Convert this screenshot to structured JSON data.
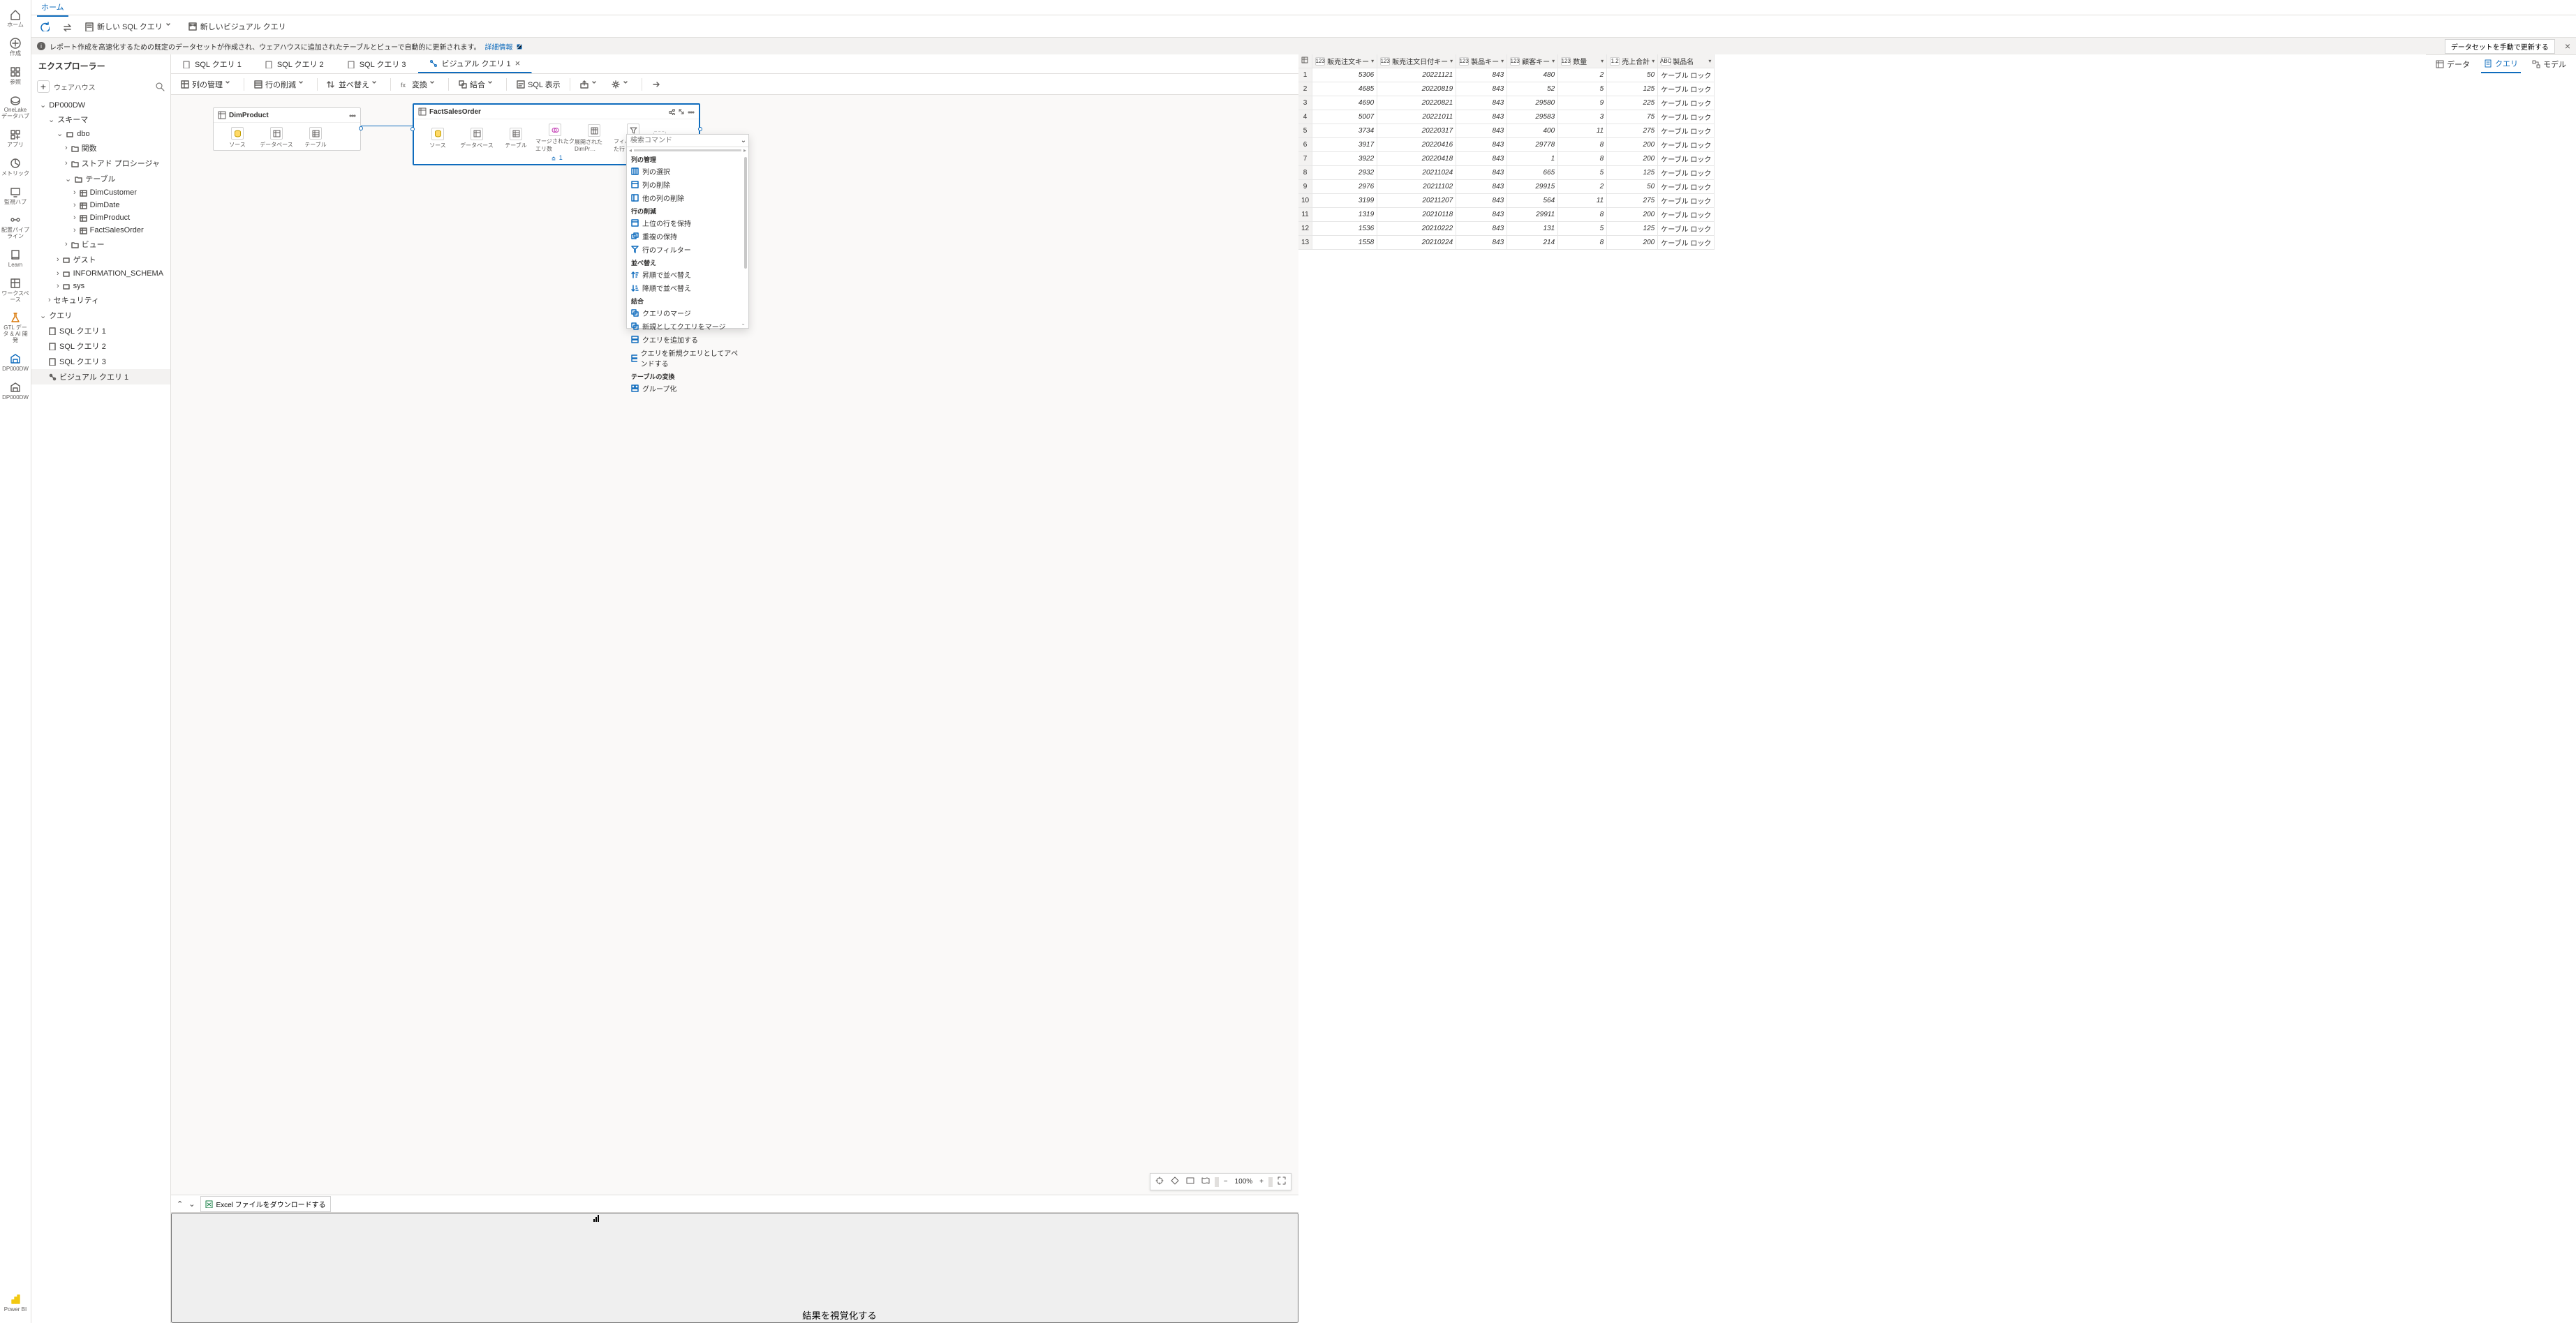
{
  "rail": [
    {
      "icon": "home",
      "label": "ホーム"
    },
    {
      "icon": "plus",
      "label": "作成"
    },
    {
      "icon": "grid",
      "label": "参照"
    },
    {
      "icon": "onelake",
      "label": "OneLake データハブ"
    },
    {
      "icon": "apps",
      "label": "アプリ"
    },
    {
      "icon": "metrics",
      "label": "メトリック"
    },
    {
      "icon": "monitor",
      "label": "監視ハブ"
    },
    {
      "icon": "pipeline",
      "label": "配置パイプライン"
    },
    {
      "icon": "learn",
      "label": "Learn"
    },
    {
      "icon": "workspace",
      "label": "ワークスペース"
    },
    {
      "icon": "flask",
      "label": "GTL データ & AI 開発"
    },
    {
      "icon": "dw",
      "label": "DP000DW"
    },
    {
      "icon": "dw2",
      "label": "DP000DW"
    }
  ],
  "rail_logo": "Power BI",
  "top_tab": "ホーム",
  "ribbon": {
    "refresh": "",
    "newSql": "新しい SQL クエリ",
    "newVisual": "新しいビジュアル クエリ"
  },
  "info": {
    "text": "レポート作成を高速化するための既定のデータセットが作成され、ウェアハウスに追加されたテーブルとビューで自動的に更新されます。",
    "link": "詳細情報",
    "button": "データセットを手動で更新する"
  },
  "explorer": {
    "title": "エクスプローラー",
    "search_label": "ウェアハウス",
    "nodes": {
      "db": "DP000DW",
      "schema": "スキーマ",
      "dbo": "dbo",
      "func": "関数",
      "sproc": "ストアド プロシージャ",
      "table": "テーブル",
      "tables": [
        "DimCustomer",
        "DimDate",
        "DimProduct",
        "FactSalesOrder"
      ],
      "view": "ビュー",
      "guest": "ゲスト",
      "info_schema": "INFORMATION_SCHEMA",
      "sys": "sys",
      "security": "セキュリティ",
      "query": "クエリ",
      "queries": [
        "SQL クエリ 1",
        "SQL クエリ 2",
        "SQL クエリ 3",
        "ビジュアル クエリ 1"
      ]
    }
  },
  "queryTabs": [
    "SQL クエリ 1",
    "SQL クエリ 2",
    "SQL クエリ 3",
    "ビジュアル クエリ 1"
  ],
  "activeTab": 3,
  "vtoolbar": {
    "manageCols": "列の管理",
    "reduceRows": "行の削減",
    "sort": "並べ替え",
    "transform": "変換",
    "combine": "結合",
    "sqlView": "SQL 表示"
  },
  "diagram": {
    "nodeA": {
      "title": "DimProduct",
      "steps": [
        "ソース",
        "データベース",
        "テーブル"
      ]
    },
    "nodeB": {
      "title": "FactSalesOrder",
      "steps": [
        "ソース",
        "データベース",
        "テーブル",
        "マージされたクエリ数",
        "展開された DimPr…",
        "フィルターされた行"
      ],
      "footer": "1"
    }
  },
  "ctx": {
    "search": "検索コマンド",
    "groups": [
      {
        "title": "列の管理",
        "items": [
          "列の選択",
          "列の削除",
          "他の列の削除"
        ]
      },
      {
        "title": "行の削減",
        "items": [
          "上位の行を保持",
          "重複の保持",
          "行のフィルター"
        ]
      },
      {
        "title": "並べ替え",
        "items": [
          "昇順で並べ替え",
          "降順で並べ替え"
        ]
      },
      {
        "title": "結合",
        "items": [
          "クエリのマージ",
          "新規としてクエリをマージ",
          "クエリを追加する",
          "クエリを新規クエリとしてアペンドする"
        ]
      },
      {
        "title": "テーブルの変換",
        "items": [
          "グループ化"
        ]
      }
    ]
  },
  "split": {
    "download": "Excel ファイルをダウンロードする",
    "visualize": "結果を視覚化する"
  },
  "grid": {
    "columns": [
      {
        "name": "販売注文キー",
        "type": "123"
      },
      {
        "name": "販売注文日付キー",
        "type": "123"
      },
      {
        "name": "製品キー",
        "type": "123"
      },
      {
        "name": "顧客キー",
        "type": "123"
      },
      {
        "name": "数量",
        "type": "123"
      },
      {
        "name": "売上合計",
        "type": "1.2"
      },
      {
        "name": "製品名",
        "type": "ABC"
      }
    ],
    "rows": [
      [
        "5306",
        "20221121",
        "843",
        "480",
        "2",
        "50",
        "ケーブル ロック"
      ],
      [
        "4685",
        "20220819",
        "843",
        "52",
        "5",
        "125",
        "ケーブル ロック"
      ],
      [
        "4690",
        "20220821",
        "843",
        "29580",
        "9",
        "225",
        "ケーブル ロック"
      ],
      [
        "5007",
        "20221011",
        "843",
        "29583",
        "3",
        "75",
        "ケーブル ロック"
      ],
      [
        "3734",
        "20220317",
        "843",
        "400",
        "11",
        "275",
        "ケーブル ロック"
      ],
      [
        "3917",
        "20220416",
        "843",
        "29778",
        "8",
        "200",
        "ケーブル ロック"
      ],
      [
        "3922",
        "20220418",
        "843",
        "1",
        "8",
        "200",
        "ケーブル ロック"
      ],
      [
        "2932",
        "20211024",
        "843",
        "665",
        "5",
        "125",
        "ケーブル ロック"
      ],
      [
        "2976",
        "20211102",
        "843",
        "29915",
        "2",
        "50",
        "ケーブル ロック"
      ],
      [
        "3199",
        "20211207",
        "843",
        "564",
        "11",
        "275",
        "ケーブル ロック"
      ],
      [
        "1319",
        "20210118",
        "843",
        "29911",
        "8",
        "200",
        "ケーブル ロック"
      ],
      [
        "1536",
        "20210222",
        "843",
        "131",
        "5",
        "125",
        "ケーブル ロック"
      ],
      [
        "1558",
        "20210224",
        "843",
        "214",
        "8",
        "200",
        "ケーブル ロック"
      ]
    ]
  },
  "zoom": {
    "value": "100%"
  },
  "bottomTabs": [
    "データ",
    "クエリ",
    "モデル"
  ]
}
